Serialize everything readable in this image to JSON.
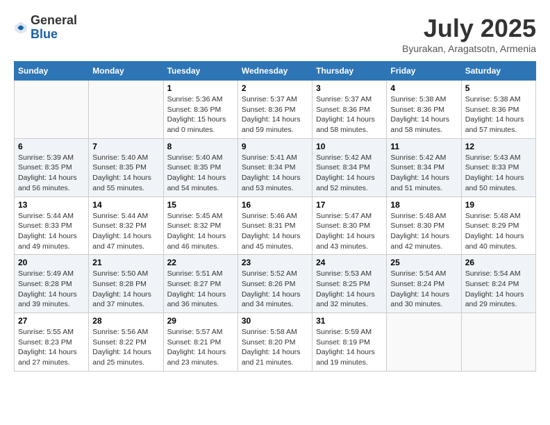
{
  "header": {
    "logo_general": "General",
    "logo_blue": "Blue",
    "month_title": "July 2025",
    "location": "Byurakan, Aragatsotn, Armenia"
  },
  "days_of_week": [
    "Sunday",
    "Monday",
    "Tuesday",
    "Wednesday",
    "Thursday",
    "Friday",
    "Saturday"
  ],
  "weeks": [
    [
      {
        "day": "",
        "info": ""
      },
      {
        "day": "",
        "info": ""
      },
      {
        "day": "1",
        "info": "Sunrise: 5:36 AM\nSunset: 8:36 PM\nDaylight: 15 hours\nand 0 minutes."
      },
      {
        "day": "2",
        "info": "Sunrise: 5:37 AM\nSunset: 8:36 PM\nDaylight: 14 hours\nand 59 minutes."
      },
      {
        "day": "3",
        "info": "Sunrise: 5:37 AM\nSunset: 8:36 PM\nDaylight: 14 hours\nand 58 minutes."
      },
      {
        "day": "4",
        "info": "Sunrise: 5:38 AM\nSunset: 8:36 PM\nDaylight: 14 hours\nand 58 minutes."
      },
      {
        "day": "5",
        "info": "Sunrise: 5:38 AM\nSunset: 8:36 PM\nDaylight: 14 hours\nand 57 minutes."
      }
    ],
    [
      {
        "day": "6",
        "info": "Sunrise: 5:39 AM\nSunset: 8:35 PM\nDaylight: 14 hours\nand 56 minutes."
      },
      {
        "day": "7",
        "info": "Sunrise: 5:40 AM\nSunset: 8:35 PM\nDaylight: 14 hours\nand 55 minutes."
      },
      {
        "day": "8",
        "info": "Sunrise: 5:40 AM\nSunset: 8:35 PM\nDaylight: 14 hours\nand 54 minutes."
      },
      {
        "day": "9",
        "info": "Sunrise: 5:41 AM\nSunset: 8:34 PM\nDaylight: 14 hours\nand 53 minutes."
      },
      {
        "day": "10",
        "info": "Sunrise: 5:42 AM\nSunset: 8:34 PM\nDaylight: 14 hours\nand 52 minutes."
      },
      {
        "day": "11",
        "info": "Sunrise: 5:42 AM\nSunset: 8:34 PM\nDaylight: 14 hours\nand 51 minutes."
      },
      {
        "day": "12",
        "info": "Sunrise: 5:43 AM\nSunset: 8:33 PM\nDaylight: 14 hours\nand 50 minutes."
      }
    ],
    [
      {
        "day": "13",
        "info": "Sunrise: 5:44 AM\nSunset: 8:33 PM\nDaylight: 14 hours\nand 49 minutes."
      },
      {
        "day": "14",
        "info": "Sunrise: 5:44 AM\nSunset: 8:32 PM\nDaylight: 14 hours\nand 47 minutes."
      },
      {
        "day": "15",
        "info": "Sunrise: 5:45 AM\nSunset: 8:32 PM\nDaylight: 14 hours\nand 46 minutes."
      },
      {
        "day": "16",
        "info": "Sunrise: 5:46 AM\nSunset: 8:31 PM\nDaylight: 14 hours\nand 45 minutes."
      },
      {
        "day": "17",
        "info": "Sunrise: 5:47 AM\nSunset: 8:30 PM\nDaylight: 14 hours\nand 43 minutes."
      },
      {
        "day": "18",
        "info": "Sunrise: 5:48 AM\nSunset: 8:30 PM\nDaylight: 14 hours\nand 42 minutes."
      },
      {
        "day": "19",
        "info": "Sunrise: 5:48 AM\nSunset: 8:29 PM\nDaylight: 14 hours\nand 40 minutes."
      }
    ],
    [
      {
        "day": "20",
        "info": "Sunrise: 5:49 AM\nSunset: 8:28 PM\nDaylight: 14 hours\nand 39 minutes."
      },
      {
        "day": "21",
        "info": "Sunrise: 5:50 AM\nSunset: 8:28 PM\nDaylight: 14 hours\nand 37 minutes."
      },
      {
        "day": "22",
        "info": "Sunrise: 5:51 AM\nSunset: 8:27 PM\nDaylight: 14 hours\nand 36 minutes."
      },
      {
        "day": "23",
        "info": "Sunrise: 5:52 AM\nSunset: 8:26 PM\nDaylight: 14 hours\nand 34 minutes."
      },
      {
        "day": "24",
        "info": "Sunrise: 5:53 AM\nSunset: 8:25 PM\nDaylight: 14 hours\nand 32 minutes."
      },
      {
        "day": "25",
        "info": "Sunrise: 5:54 AM\nSunset: 8:24 PM\nDaylight: 14 hours\nand 30 minutes."
      },
      {
        "day": "26",
        "info": "Sunrise: 5:54 AM\nSunset: 8:24 PM\nDaylight: 14 hours\nand 29 minutes."
      }
    ],
    [
      {
        "day": "27",
        "info": "Sunrise: 5:55 AM\nSunset: 8:23 PM\nDaylight: 14 hours\nand 27 minutes."
      },
      {
        "day": "28",
        "info": "Sunrise: 5:56 AM\nSunset: 8:22 PM\nDaylight: 14 hours\nand 25 minutes."
      },
      {
        "day": "29",
        "info": "Sunrise: 5:57 AM\nSunset: 8:21 PM\nDaylight: 14 hours\nand 23 minutes."
      },
      {
        "day": "30",
        "info": "Sunrise: 5:58 AM\nSunset: 8:20 PM\nDaylight: 14 hours\nand 21 minutes."
      },
      {
        "day": "31",
        "info": "Sunrise: 5:59 AM\nSunset: 8:19 PM\nDaylight: 14 hours\nand 19 minutes."
      },
      {
        "day": "",
        "info": ""
      },
      {
        "day": "",
        "info": ""
      }
    ]
  ]
}
